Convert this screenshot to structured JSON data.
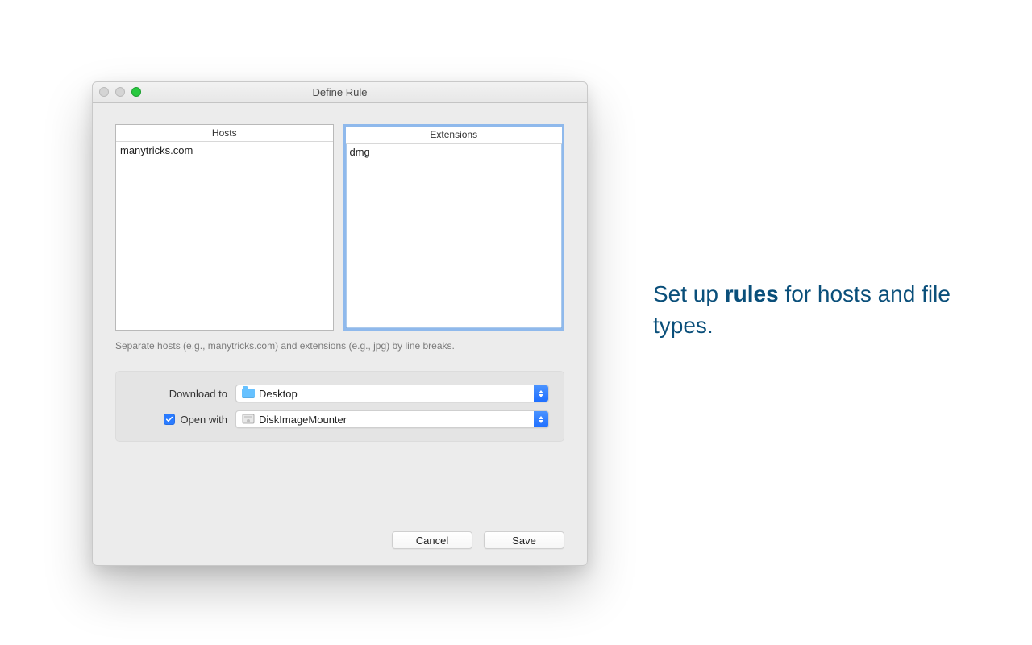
{
  "window": {
    "title": "Define Rule"
  },
  "lists": {
    "hosts": {
      "header": "Hosts",
      "content": "manytricks.com"
    },
    "extensions": {
      "header": "Extensions",
      "content": "dmg"
    }
  },
  "hint": "Separate hosts (e.g., manytricks.com) and extensions (e.g., jpg) by line breaks.",
  "options": {
    "download_label": "Download to",
    "download_value": "Desktop",
    "openwith_label": "Open with",
    "openwith_value": "DiskImageMounter",
    "openwith_checked": true
  },
  "buttons": {
    "cancel": "Cancel",
    "save": "Save"
  },
  "promo": {
    "before": "Set up ",
    "bold": "rules",
    "after": " for hosts and file types."
  }
}
